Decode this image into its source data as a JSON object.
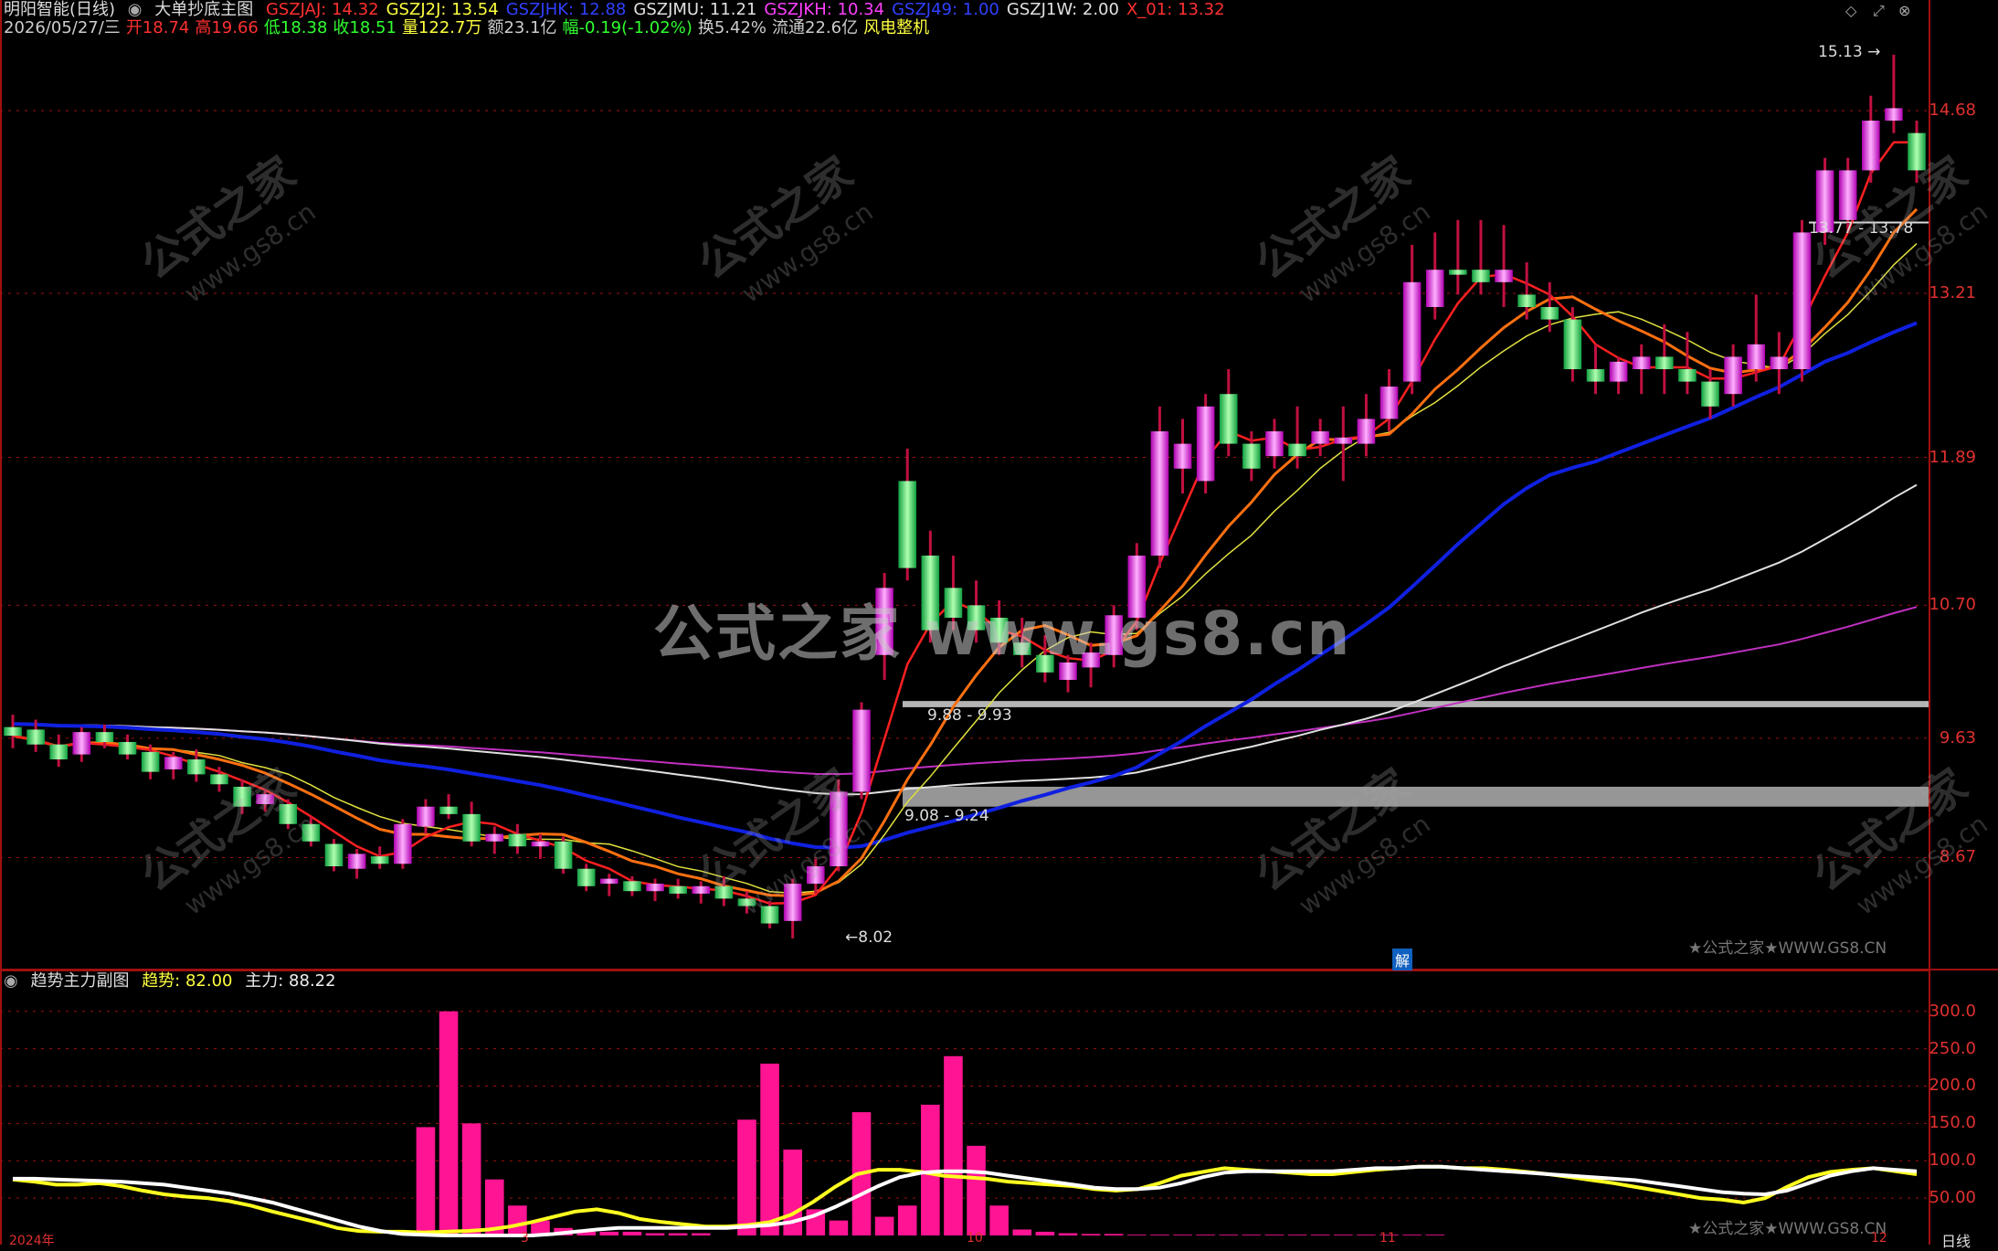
{
  "header": {
    "stock_name": "明阳智能(日线)",
    "indicator_name": "大单抄底主图",
    "params": [
      {
        "label": "GSZJAJ: 14.32",
        "color": "#ff3030"
      },
      {
        "label": "GSZJ2J: 13.54",
        "color": "#ffff40"
      },
      {
        "label": "GSZJHK: 12.88",
        "color": "#3040ff"
      },
      {
        "label": "GSZJMU: 11.21",
        "color": "#e0e0e0"
      },
      {
        "label": "GSZJKH: 10.34",
        "color": "#ff40ff"
      },
      {
        "label": "GSZJ49: 1.00",
        "color": "#3040ff"
      },
      {
        "label": "GSZJ1W: 2.00",
        "color": "#e0e0e0"
      },
      {
        "label": "X_01: 13.32",
        "color": "#ff3030"
      }
    ],
    "quote": [
      {
        "label": "2026/05/27/三",
        "color": "#cccccc"
      },
      {
        "label": "开18.74",
        "color": "#ff3030"
      },
      {
        "label": "高19.66",
        "color": "#ff3030"
      },
      {
        "label": "低18.38",
        "color": "#30ff30"
      },
      {
        "label": "收18.51",
        "color": "#30ff30"
      },
      {
        "label": "量122.7万",
        "color": "#ffff40"
      },
      {
        "label": "额23.1亿",
        "color": "#cccccc"
      },
      {
        "label": "幅-0.19(-1.02%)",
        "color": "#30ff30"
      },
      {
        "label": "换5.42%",
        "color": "#cccccc"
      },
      {
        "label": "流通22.6亿",
        "color": "#cccccc"
      },
      {
        "label": "风电整机",
        "color": "#ffff40"
      }
    ]
  },
  "price_axis": {
    "ticks": [
      "14.68",
      "13.21",
      "11.89",
      "10.70",
      "9.63",
      "8.67"
    ]
  },
  "annotations": {
    "high": "15.13",
    "low": "8.02",
    "zone_upper": "9.88 - 9.93",
    "zone_lower": "9.08 - 9.24",
    "zone_top": "13.77 - 13.78",
    "jie_badge": "解"
  },
  "watermark": {
    "big": "公式之家 www.gs8.cn",
    "cn": "公式之家",
    "url": "www.gs8.cn",
    "corner": "★公式之家★WWW.GS8.CN"
  },
  "sub_panel": {
    "title": "趋势主力副图",
    "trend_label": "趋势: 82.00",
    "main_label": "主力: 88.22",
    "ticks": [
      "300.0",
      "250.0",
      "200.0",
      "150.0",
      "100.0",
      "50.00"
    ],
    "corner": "★公式之家★WWW.GS8.CN"
  },
  "footer": {
    "unit_label": "日线",
    "date_labels": [
      "2024年",
      "3",
      "10",
      "11",
      "12"
    ]
  },
  "colors": {
    "up": "#ff40ff",
    "down": "#30e060",
    "ma_red": "#ff2020",
    "ma_orange": "#ff7010",
    "ma_yellow": "#e0e040",
    "ma_blue": "#1020e0",
    "ma_white": "#e0e0e0",
    "ma_magenta": "#c030c0",
    "bar_pink": "#ff1493",
    "line_trend": "#ffff20",
    "line_main": "#ffffff",
    "grid": "#a01010"
  },
  "chart_data": {
    "type": "candlestick",
    "y_axis_ticks": [
      14.68,
      13.21,
      11.89,
      10.7,
      9.63,
      8.67
    ],
    "high": 15.13,
    "low": 8.02,
    "candles": [
      {
        "o": 9.72,
        "h": 9.82,
        "l": 9.55,
        "c": 9.65
      },
      {
        "o": 9.7,
        "h": 9.78,
        "l": 9.52,
        "c": 9.58
      },
      {
        "o": 9.58,
        "h": 9.66,
        "l": 9.4,
        "c": 9.46
      },
      {
        "o": 9.5,
        "h": 9.72,
        "l": 9.44,
        "c": 9.68
      },
      {
        "o": 9.68,
        "h": 9.74,
        "l": 9.55,
        "c": 9.6
      },
      {
        "o": 9.6,
        "h": 9.66,
        "l": 9.46,
        "c": 9.5
      },
      {
        "o": 9.52,
        "h": 9.58,
        "l": 9.3,
        "c": 9.36
      },
      {
        "o": 9.38,
        "h": 9.52,
        "l": 9.3,
        "c": 9.48
      },
      {
        "o": 9.46,
        "h": 9.54,
        "l": 9.28,
        "c": 9.34
      },
      {
        "o": 9.34,
        "h": 9.4,
        "l": 9.2,
        "c": 9.26
      },
      {
        "o": 9.24,
        "h": 9.3,
        "l": 9.02,
        "c": 9.08
      },
      {
        "o": 9.1,
        "h": 9.22,
        "l": 9.04,
        "c": 9.18
      },
      {
        "o": 9.1,
        "h": 9.14,
        "l": 8.9,
        "c": 8.94
      },
      {
        "o": 8.94,
        "h": 9.0,
        "l": 8.76,
        "c": 8.8
      },
      {
        "o": 8.78,
        "h": 8.82,
        "l": 8.56,
        "c": 8.6
      },
      {
        "o": 8.58,
        "h": 8.74,
        "l": 8.5,
        "c": 8.7
      },
      {
        "o": 8.68,
        "h": 8.76,
        "l": 8.58,
        "c": 8.62
      },
      {
        "o": 8.62,
        "h": 8.98,
        "l": 8.58,
        "c": 8.94
      },
      {
        "o": 8.92,
        "h": 9.14,
        "l": 8.86,
        "c": 9.08
      },
      {
        "o": 9.08,
        "h": 9.18,
        "l": 8.98,
        "c": 9.02
      },
      {
        "o": 9.02,
        "h": 9.12,
        "l": 8.76,
        "c": 8.8
      },
      {
        "o": 8.8,
        "h": 8.92,
        "l": 8.7,
        "c": 8.86
      },
      {
        "o": 8.86,
        "h": 8.94,
        "l": 8.7,
        "c": 8.76
      },
      {
        "o": 8.76,
        "h": 8.86,
        "l": 8.66,
        "c": 8.8
      },
      {
        "o": 8.8,
        "h": 8.84,
        "l": 8.54,
        "c": 8.58
      },
      {
        "o": 8.58,
        "h": 8.62,
        "l": 8.4,
        "c": 8.44
      },
      {
        "o": 8.46,
        "h": 8.54,
        "l": 8.36,
        "c": 8.5
      },
      {
        "o": 8.48,
        "h": 8.52,
        "l": 8.36,
        "c": 8.4
      },
      {
        "o": 8.4,
        "h": 8.5,
        "l": 8.32,
        "c": 8.46
      },
      {
        "o": 8.44,
        "h": 8.5,
        "l": 8.34,
        "c": 8.38
      },
      {
        "o": 8.38,
        "h": 8.48,
        "l": 8.3,
        "c": 8.44
      },
      {
        "o": 8.44,
        "h": 8.52,
        "l": 8.28,
        "c": 8.34
      },
      {
        "o": 8.34,
        "h": 8.4,
        "l": 8.22,
        "c": 8.28
      },
      {
        "o": 8.28,
        "h": 8.32,
        "l": 8.1,
        "c": 8.14
      },
      {
        "o": 8.16,
        "h": 8.5,
        "l": 8.02,
        "c": 8.46
      },
      {
        "o": 8.46,
        "h": 8.66,
        "l": 8.38,
        "c": 8.6
      },
      {
        "o": 8.6,
        "h": 9.3,
        "l": 8.56,
        "c": 9.2
      },
      {
        "o": 9.2,
        "h": 9.92,
        "l": 9.14,
        "c": 9.86
      },
      {
        "o": 10.3,
        "h": 10.96,
        "l": 10.1,
        "c": 10.84
      },
      {
        "o": 11.7,
        "h": 11.96,
        "l": 10.9,
        "c": 11.0
      },
      {
        "o": 11.1,
        "h": 11.3,
        "l": 10.4,
        "c": 10.5
      },
      {
        "o": 10.84,
        "h": 11.1,
        "l": 10.5,
        "c": 10.6
      },
      {
        "o": 10.7,
        "h": 10.9,
        "l": 10.4,
        "c": 10.5
      },
      {
        "o": 10.6,
        "h": 10.74,
        "l": 10.3,
        "c": 10.4
      },
      {
        "o": 10.4,
        "h": 10.6,
        "l": 10.2,
        "c": 10.3
      },
      {
        "o": 10.3,
        "h": 10.46,
        "l": 10.08,
        "c": 10.16
      },
      {
        "o": 10.1,
        "h": 10.3,
        "l": 10.0,
        "c": 10.24
      },
      {
        "o": 10.2,
        "h": 10.4,
        "l": 10.04,
        "c": 10.32
      },
      {
        "o": 10.3,
        "h": 10.7,
        "l": 10.2,
        "c": 10.62
      },
      {
        "o": 10.6,
        "h": 11.2,
        "l": 10.5,
        "c": 11.1
      },
      {
        "o": 11.1,
        "h": 12.3,
        "l": 11.0,
        "c": 12.1
      },
      {
        "o": 11.8,
        "h": 12.2,
        "l": 11.6,
        "c": 12.0
      },
      {
        "o": 11.7,
        "h": 12.4,
        "l": 11.6,
        "c": 12.3
      },
      {
        "o": 12.4,
        "h": 12.6,
        "l": 11.9,
        "c": 12.0
      },
      {
        "o": 12.0,
        "h": 12.1,
        "l": 11.7,
        "c": 11.8
      },
      {
        "o": 11.9,
        "h": 12.2,
        "l": 11.8,
        "c": 12.1
      },
      {
        "o": 12.0,
        "h": 12.3,
        "l": 11.8,
        "c": 11.9
      },
      {
        "o": 12.0,
        "h": 12.2,
        "l": 11.9,
        "c": 12.1
      },
      {
        "o": 12.0,
        "h": 12.3,
        "l": 11.7,
        "c": 12.05
      },
      {
        "o": 12.0,
        "h": 12.4,
        "l": 11.9,
        "c": 12.2
      },
      {
        "o": 12.2,
        "h": 12.6,
        "l": 12.1,
        "c": 12.46
      },
      {
        "o": 12.5,
        "h": 13.6,
        "l": 12.4,
        "c": 13.3
      },
      {
        "o": 13.1,
        "h": 13.7,
        "l": 13.0,
        "c": 13.4
      },
      {
        "o": 13.4,
        "h": 13.8,
        "l": 13.2,
        "c": 13.36
      },
      {
        "o": 13.4,
        "h": 13.8,
        "l": 13.2,
        "c": 13.3
      },
      {
        "o": 13.3,
        "h": 13.76,
        "l": 13.1,
        "c": 13.4
      },
      {
        "o": 13.2,
        "h": 13.46,
        "l": 13.0,
        "c": 13.1
      },
      {
        "o": 13.1,
        "h": 13.3,
        "l": 12.9,
        "c": 13.0
      },
      {
        "o": 13.0,
        "h": 13.1,
        "l": 12.5,
        "c": 12.6
      },
      {
        "o": 12.6,
        "h": 12.8,
        "l": 12.4,
        "c": 12.5
      },
      {
        "o": 12.5,
        "h": 12.7,
        "l": 12.4,
        "c": 12.66
      },
      {
        "o": 12.6,
        "h": 12.8,
        "l": 12.4,
        "c": 12.7
      },
      {
        "o": 12.7,
        "h": 12.96,
        "l": 12.4,
        "c": 12.6
      },
      {
        "o": 12.6,
        "h": 12.9,
        "l": 12.4,
        "c": 12.5
      },
      {
        "o": 12.5,
        "h": 12.6,
        "l": 12.2,
        "c": 12.3
      },
      {
        "o": 12.4,
        "h": 12.8,
        "l": 12.3,
        "c": 12.7
      },
      {
        "o": 12.6,
        "h": 13.2,
        "l": 12.5,
        "c": 12.8
      },
      {
        "o": 12.6,
        "h": 12.9,
        "l": 12.4,
        "c": 12.7
      },
      {
        "o": 12.6,
        "h": 13.8,
        "l": 12.5,
        "c": 13.7
      },
      {
        "o": 13.7,
        "h": 14.3,
        "l": 13.6,
        "c": 14.2
      },
      {
        "o": 13.8,
        "h": 14.3,
        "l": 13.7,
        "c": 14.2
      },
      {
        "o": 14.2,
        "h": 14.8,
        "l": 14.1,
        "c": 14.6
      },
      {
        "o": 14.6,
        "h": 15.13,
        "l": 14.5,
        "c": 14.7
      },
      {
        "o": 14.5,
        "h": 14.6,
        "l": 14.1,
        "c": 14.2
      }
    ],
    "zones": [
      {
        "label": "9.88 - 9.93",
        "low": 9.88,
        "high": 9.93
      },
      {
        "label": "9.08 - 9.24",
        "low": 9.08,
        "high": 9.24
      }
    ],
    "sub_bars": [
      0,
      0,
      0,
      0,
      0,
      0,
      0,
      0,
      0,
      0,
      0,
      0,
      0,
      0,
      0,
      0,
      0,
      0,
      145,
      300,
      150,
      75,
      40,
      20,
      10,
      5,
      5,
      5,
      3,
      3,
      3,
      0,
      155,
      230,
      115,
      35,
      20,
      165,
      25,
      40,
      175,
      240,
      120,
      40,
      8,
      5,
      3,
      2,
      2,
      1,
      1,
      1,
      1,
      1,
      1,
      1,
      1,
      1,
      1,
      1,
      1,
      1,
      1
    ],
    "sub_trend": [
      75,
      72,
      68,
      68,
      70,
      66,
      60,
      55,
      52,
      50,
      46,
      40,
      32,
      25,
      18,
      10,
      6,
      5,
      5,
      4,
      5,
      6,
      8,
      12,
      18,
      25,
      32,
      35,
      30,
      22,
      18,
      15,
      12,
      12,
      14,
      18,
      28,
      45,
      65,
      82,
      88,
      88,
      85,
      80,
      78,
      76,
      72,
      70,
      68,
      66,
      62,
      60,
      62,
      70,
      80,
      85,
      90,
      88,
      86,
      84,
      82,
      82,
      85,
      88,
      90,
      92,
      92,
      90,
      90,
      88,
      85,
      82,
      78,
      74,
      70,
      65,
      60,
      55,
      50,
      48,
      44,
      50,
      65,
      78,
      85,
      88,
      90,
      86,
      82
    ],
    "sub_main": [
      76,
      76,
      75,
      74,
      73,
      72,
      70,
      68,
      64,
      60,
      56,
      50,
      44,
      36,
      28,
      20,
      12,
      6,
      2,
      1,
      0,
      0,
      0,
      0,
      0,
      2,
      5,
      8,
      10,
      10,
      10,
      10,
      10,
      10,
      12,
      14,
      18,
      26,
      38,
      52,
      66,
      78,
      84,
      86,
      86,
      84,
      80,
      76,
      72,
      68,
      64,
      62,
      62,
      64,
      70,
      78,
      84,
      86,
      86,
      86,
      86,
      86,
      88,
      90,
      90,
      92,
      92,
      90,
      88,
      86,
      84,
      82,
      80,
      78,
      76,
      74,
      70,
      66,
      62,
      58,
      56,
      55,
      60,
      70,
      80,
      86,
      90,
      88,
      86
    ]
  }
}
